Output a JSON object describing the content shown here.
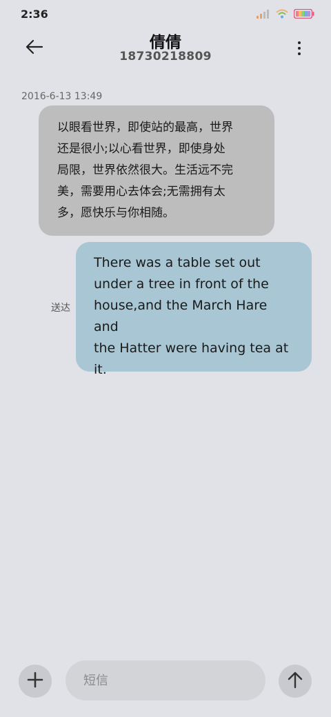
{
  "status_bar": {
    "time": "2:36",
    "icons": [
      "signal-icon",
      "wifi-icon",
      "battery-icon"
    ]
  },
  "header": {
    "back_icon": "arrow-left-icon",
    "contact_name": "倩倩",
    "contact_number": "18730218809",
    "more_icon": "more-vertical-icon"
  },
  "conversation": {
    "timestamp": "2016-6-13 13:49",
    "messages": [
      {
        "direction": "incoming",
        "text": "以眼看世界，即使站的最高，世界还是很小;以心看世界，即使身处局限，世界依然很大。生活远不完美，需要用心去体会;无需拥有太多，愿快乐与你相随。",
        "lines": [
          "以眼看世界，即使站的最高，世界",
          "还是很小;以心看世界，即使身处",
          "局限，世界依然很大。生活远不完",
          "美，需要用心去体会;无需拥有太",
          "多，愿快乐与你相随。"
        ]
      },
      {
        "direction": "outgoing",
        "status": "送达",
        "text": "There was a table set out under a tree in front of the house,and the March Hare and the Hatter were having tea at it.",
        "lines": [
          "There was a table set out",
          "under a tree in front of the",
          "house,and the March Hare and",
          "the Hatter were having tea at",
          "it."
        ]
      }
    ]
  },
  "composer": {
    "add_icon": "plus-icon",
    "placeholder": "短信",
    "send_icon": "arrow-up-icon"
  },
  "colors": {
    "background": "#e1e2e7",
    "incoming_bubble": "#bdbdbd",
    "outgoing_bubble": "#a8c6d4",
    "button": "#c9cacf"
  }
}
